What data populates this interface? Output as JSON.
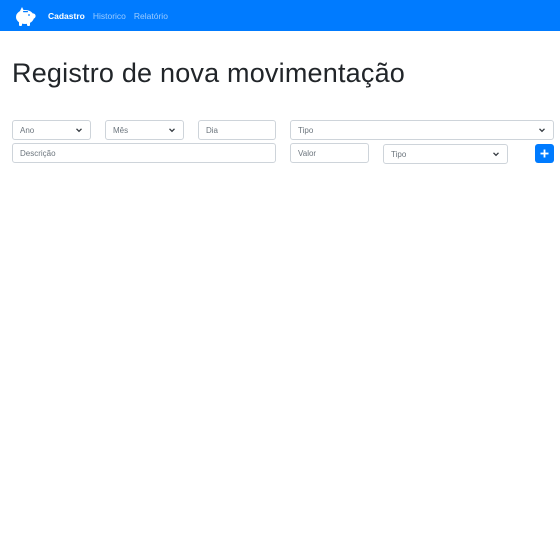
{
  "navbar": {
    "brand_icon": "piggy-bank-icon",
    "links": [
      {
        "label": "Cadastro",
        "active": true
      },
      {
        "label": "Historico",
        "active": false
      },
      {
        "label": "Relatório",
        "active": false
      }
    ]
  },
  "page": {
    "title": "Registro de nova movimentação"
  },
  "form": {
    "ano": {
      "selected": "Ano"
    },
    "mes": {
      "selected": "Mês"
    },
    "dia": {
      "placeholder": "Dia"
    },
    "tipo": {
      "selected": "Tipo"
    },
    "descricao": {
      "placeholder": "Descrição"
    },
    "valor": {
      "placeholder": "Valor"
    },
    "tipo2": {
      "selected": "Tipo"
    },
    "add_button_icon": "plus-icon"
  },
  "colors": {
    "primary": "#007bff",
    "border": "#ced4da",
    "placeholder": "#6c757d"
  }
}
